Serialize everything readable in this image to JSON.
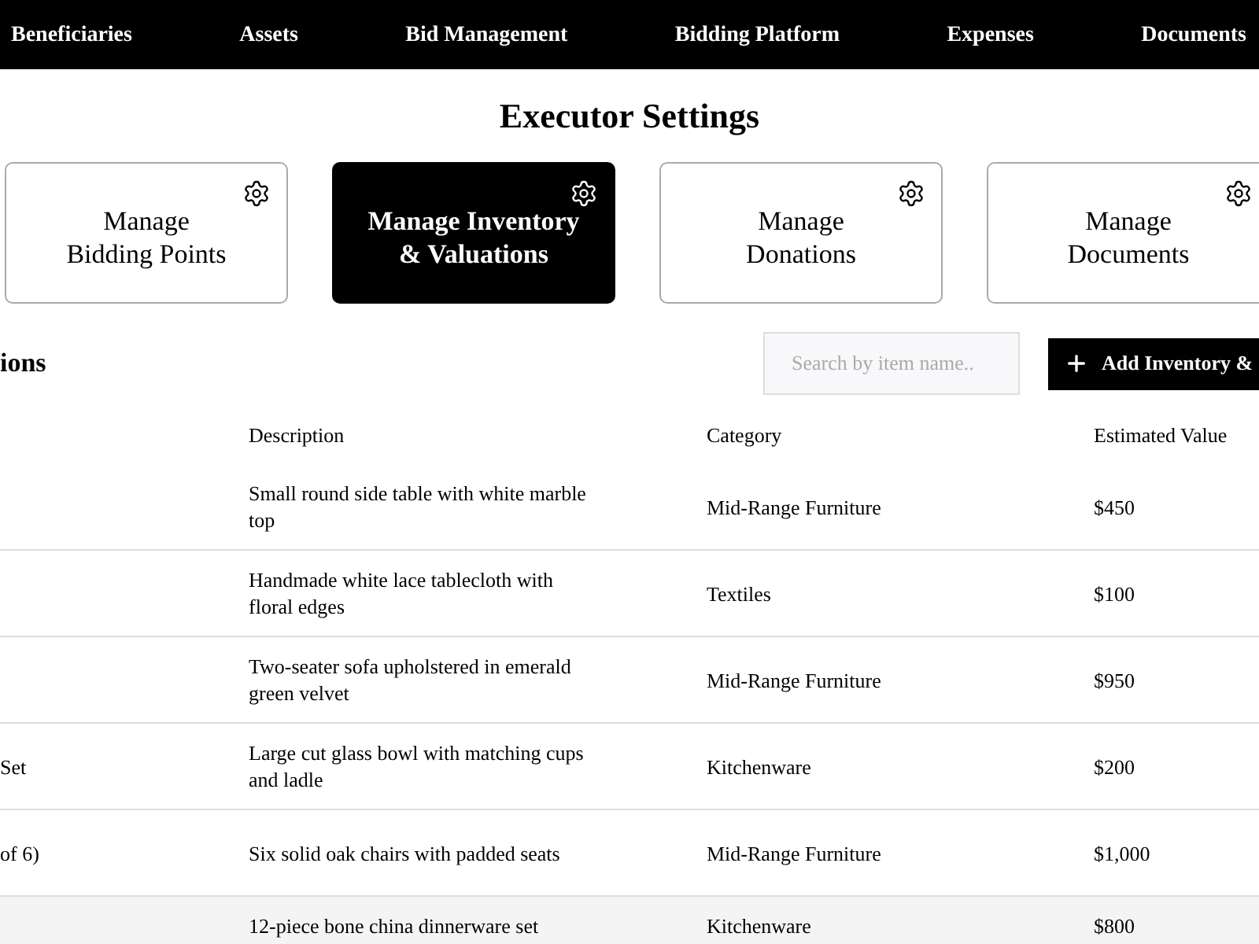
{
  "nav": [
    {
      "label": "Beneficiaries"
    },
    {
      "label": "Assets"
    },
    {
      "label": "Bid Management"
    },
    {
      "label": "Bidding Platform"
    },
    {
      "label": "Expenses"
    },
    {
      "label": "Documents"
    }
  ],
  "title": "Executor Settings",
  "cards": [
    {
      "line1": "Manage",
      "line2": "Bidding Points",
      "selected": false
    },
    {
      "line1": "Manage Inventory",
      "line2": "& Valuations",
      "selected": true
    },
    {
      "line1": "Manage",
      "line2": "Donations",
      "selected": false
    },
    {
      "line1": "Manage",
      "line2": "Documents",
      "selected": false
    }
  ],
  "section_title": "ions",
  "search": {
    "placeholder": "Search by item name.."
  },
  "add_button": "Add Inventory &",
  "table": {
    "columns": [
      "Description",
      "Category",
      "Estimated Value"
    ],
    "rows": [
      {
        "column_1": "",
        "description": "Small round side table with white marble top",
        "category": "Mid-Range Furniture",
        "value": "$450"
      },
      {
        "column_1": "",
        "description": "Handmade white lace tablecloth with floral edges",
        "category": "Textiles",
        "value": "$100"
      },
      {
        "column_1": "",
        "description": "Two-seater sofa upholstered in emerald green velvet",
        "category": "Mid-Range Furniture",
        "value": "$950"
      },
      {
        "column_1": "Set",
        "description": "Large cut glass bowl with matching cups and ladle",
        "category": "Kitchenware",
        "value": "$200"
      },
      {
        "column_1": "of 6)",
        "description": "Six solid oak chairs with padded seats",
        "category": "Mid-Range Furniture",
        "value": "$1,000"
      },
      {
        "column_1": "",
        "description": "12-piece bone china dinnerware set",
        "category": "Kitchenware",
        "value": "$800"
      }
    ]
  }
}
